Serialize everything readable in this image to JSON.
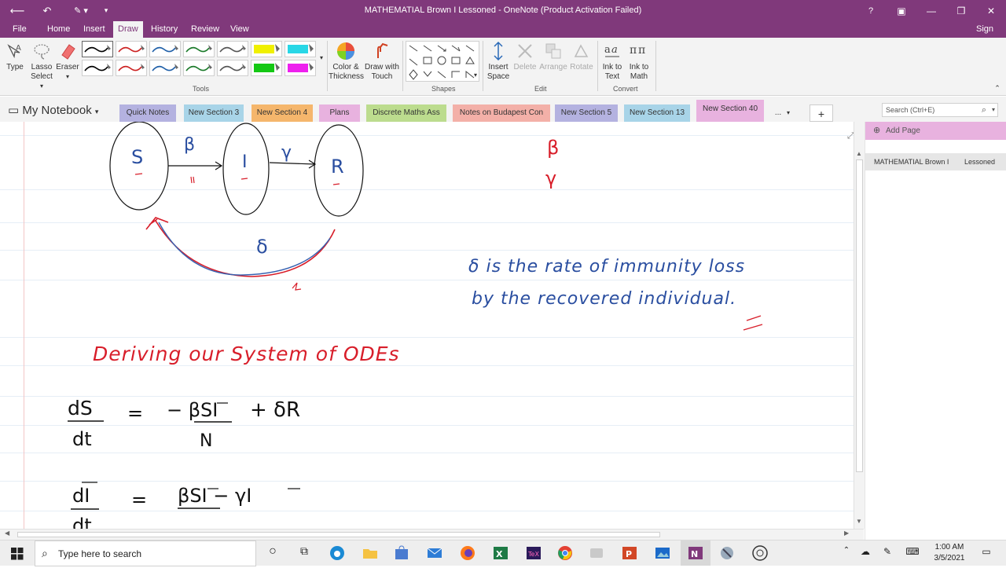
{
  "titlebar": {
    "title": "MATHEMATIAL Brown I    Lessoned - OneNote (Product Activation Failed)",
    "help": "?",
    "back_icon": "back-arrow-icon",
    "undo_icon": "undo-icon"
  },
  "menu": {
    "items": [
      "File",
      "Home",
      "Insert",
      "Draw",
      "History",
      "Review",
      "View"
    ],
    "active": "Draw",
    "signin": "Sign in"
  },
  "ribbon": {
    "tools": {
      "type": "Type",
      "lasso": "Lasso Select",
      "eraser": "Eraser",
      "group": "Tools"
    },
    "pen_colors": [
      "#000000",
      "#cc2222",
      "#1f5fa8",
      "#1b7a2a",
      "#555555",
      "#f0f000",
      "#28d7e6",
      "#000000",
      "#cc2222",
      "#1f5fa8",
      "#1b7a2a",
      "#555555",
      "#14c814",
      "#ee20ee"
    ],
    "color_thickness": "Color & Thickness",
    "draw_touch": "Draw with Touch",
    "shapes_group": "Shapes",
    "insert_space": "Insert Space",
    "delete": "Delete",
    "arrange": "Arrange",
    "rotate": "Rotate",
    "edit_group": "Edit",
    "ink_text": "Ink to Text",
    "ink_math": "Ink to Math",
    "convert_group": "Convert"
  },
  "notebook": {
    "name": "My Notebook",
    "sections": [
      {
        "label": "Quick Notes",
        "color": "#b4b2e0"
      },
      {
        "label": "New Section 3",
        "color": "#a8d4e8"
      },
      {
        "label": "New Section 4",
        "color": "#f5b66c"
      },
      {
        "label": "Plans",
        "color": "#e8b2df"
      },
      {
        "label": "Discrete Maths Ass",
        "color": "#bcdc8e"
      },
      {
        "label": "Notes on Budapest Con",
        "color": "#f3b0a8"
      },
      {
        "label": "New Section 5",
        "color": "#b4b2e0"
      },
      {
        "label": "New Section 13",
        "color": "#a8d4e8"
      },
      {
        "label": "New Section 40",
        "color": "#e8b2df"
      }
    ],
    "more": "...",
    "add": "+",
    "search_placeholder": "Search (Ctrl+E)"
  },
  "pages": {
    "add_page": "Add Page",
    "entries": [
      {
        "title": "MATHEMATIAL Brown I",
        "subtitle": "Lessoned"
      }
    ]
  },
  "ink": {
    "node_s": "S",
    "node_i": "I",
    "node_r": "R",
    "beta": "β",
    "gamma": "γ",
    "delta": "δ",
    "note_line1": "δ  is the rate of immunity loss",
    "note_line2": "by the recovered individual.",
    "heading": "Deriving our  System  of  ODEs",
    "eq1_lhs_num": "dS",
    "eq1_lhs_den": "dt",
    "eq1_rhs": "−  βSI",
    "eq1_rhs_den": "N",
    "eq1_rhs2": "+  δR",
    "eq2_lhs_num": "dI",
    "eq2_lhs_den": "dt",
    "eq2_rhs": "βSI  − γI",
    "equals": "="
  },
  "taskbar": {
    "search_placeholder": "Type here to search",
    "time": "1:00 AM",
    "date": "3/5/2021"
  }
}
